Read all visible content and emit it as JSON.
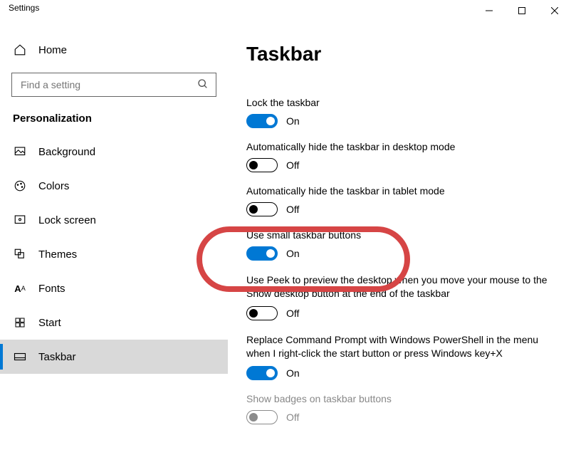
{
  "window": {
    "title": "Settings"
  },
  "home": "Home",
  "search": {
    "placeholder": "Find a setting"
  },
  "category": "Personalization",
  "nav": {
    "background": "Background",
    "colors": "Colors",
    "lockscreen": "Lock screen",
    "themes": "Themes",
    "fonts": "Fonts",
    "start": "Start",
    "taskbar": "Taskbar"
  },
  "page_title": "Taskbar",
  "settings": [
    {
      "label": "Lock the taskbar",
      "state": "On",
      "on": true
    },
    {
      "label": "Automatically hide the taskbar in desktop mode",
      "state": "Off",
      "on": false
    },
    {
      "label": "Automatically hide the taskbar in tablet mode",
      "state": "Off",
      "on": false
    },
    {
      "label": "Use small taskbar buttons",
      "state": "On",
      "on": true
    },
    {
      "label": "Use Peek to preview the desktop when you move your mouse to the Show desktop button at the end of the taskbar",
      "state": "Off",
      "on": false
    },
    {
      "label": "Replace Command Prompt with Windows PowerShell in the menu when I right-click the start button or press Windows key+X",
      "state": "On",
      "on": true
    },
    {
      "label": "Show badges on taskbar buttons",
      "state": "Off",
      "on": false,
      "disabled": true
    }
  ]
}
